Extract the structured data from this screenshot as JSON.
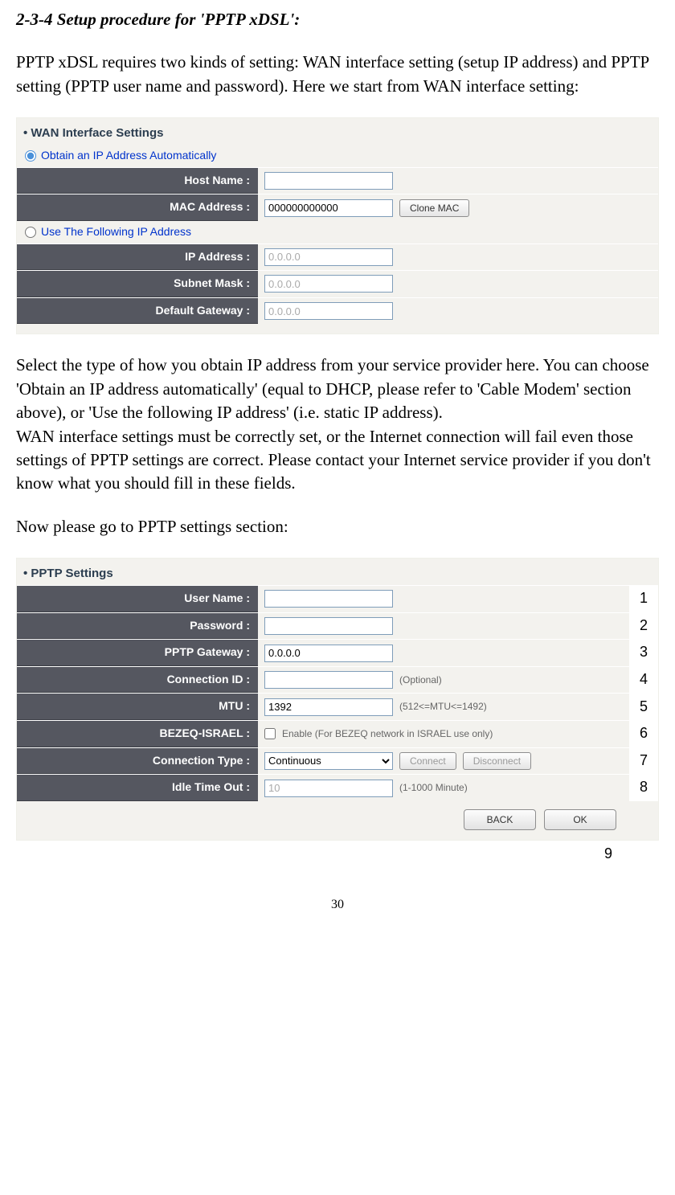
{
  "heading": "2-3-4 Setup procedure for 'PPTP xDSL':",
  "intro": "PPTP xDSL requires two kinds of setting: WAN interface setting (setup IP address) and PPTP setting (PPTP user name and password). Here we start from WAN interface setting:",
  "wan_panel": {
    "title": "WAN Interface Settings",
    "option_auto": "Obtain an IP Address Automatically",
    "option_static": "Use The Following IP Address",
    "host_name_label": "Host Name :",
    "host_name_value": "",
    "mac_label": "MAC Address :",
    "mac_value": "000000000000",
    "clone_mac_btn": "Clone MAC",
    "ip_label": "IP Address :",
    "ip_value": "0.0.0.0",
    "subnet_label": "Subnet Mask :",
    "subnet_value": "0.0.0.0",
    "gateway_label": "Default Gateway :",
    "gateway_value": "0.0.0.0"
  },
  "mid_para1": "Select the type of how you obtain IP address from your service provider here. You can choose 'Obtain an IP address automatically' (equal to DHCP, please refer to 'Cable Modem' section above), or 'Use the following IP address' (i.e. static IP address).",
  "mid_para2": "WAN interface settings must be correctly set, or the Internet connection will fail even those settings of PPTP settings are correct. Please contact your Internet service provider if you don't know what you should fill in these fields.",
  "mid_para3": "Now please go to PPTP settings section:",
  "pptp_panel": {
    "title": "PPTP Settings",
    "user_label": "User Name :",
    "user_value": "",
    "pass_label": "Password :",
    "pass_value": "",
    "gateway_label": "PPTP Gateway :",
    "gateway_value": "0.0.0.0",
    "connid_label": "Connection ID :",
    "connid_value": "",
    "connid_hint": "(Optional)",
    "mtu_label": "MTU :",
    "mtu_value": "1392",
    "mtu_hint": "(512<=MTU<=1492)",
    "bezeq_label": "BEZEQ-ISRAEL :",
    "bezeq_hint": "Enable (For BEZEQ network in ISRAEL use only)",
    "conntype_label": "Connection Type :",
    "conntype_value": "Continuous",
    "connect_btn": "Connect",
    "disconnect_btn": "Disconnect",
    "idle_label": "Idle Time Out :",
    "idle_value": "10",
    "idle_hint": "(1-1000 Minute)",
    "back_btn": "BACK",
    "ok_btn": "OK"
  },
  "annotations": {
    "a1": "1",
    "a2": "2",
    "a3": "3",
    "a4": "4",
    "a5": "5",
    "a6": "6",
    "a7": "7",
    "a8": "8",
    "a9": "9"
  },
  "page_number": "30"
}
